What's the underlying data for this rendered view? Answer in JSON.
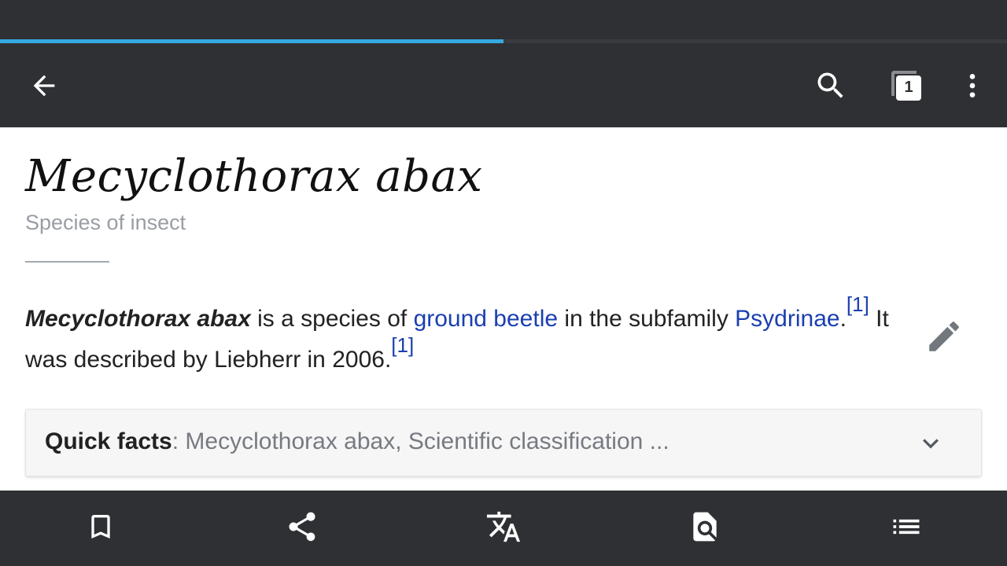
{
  "page_load": {
    "progress_fraction": 0.5
  },
  "toolbar": {
    "back_icon": "arrow-left-icon",
    "search_icon": "search-icon",
    "tabs_count": "1",
    "overflow_icon": "more-vertical-icon"
  },
  "article": {
    "title": "Mecyclothorax abax",
    "subtitle": "Species of insect",
    "lead": {
      "term": "Mecyclothorax abax",
      "text1": " is a species of ",
      "link1": "ground beetle",
      "text2": " in the subfamily ",
      "link2": "Psydrinae",
      "text3": ".",
      "ref1": "[1]",
      "text4": " It was described by Liebherr in 2006.",
      "ref2": "[1]"
    },
    "edit_icon": "pencil-icon"
  },
  "quick_facts": {
    "label": "Quick facts",
    "separator": ":",
    "summary": " Mecyclothorax abax, Scientific classification ...",
    "chevron_icon": "chevron-down-icon"
  },
  "bottom_bar": {
    "items": [
      "bookmark-icon",
      "share-icon",
      "translate-icon",
      "find-in-page-icon",
      "table-of-contents-icon"
    ]
  },
  "colors": {
    "bar_background": "#2f3033",
    "progress": "#36a9e1",
    "link": "#1a3fb0",
    "subtitle": "#9a9da3"
  }
}
